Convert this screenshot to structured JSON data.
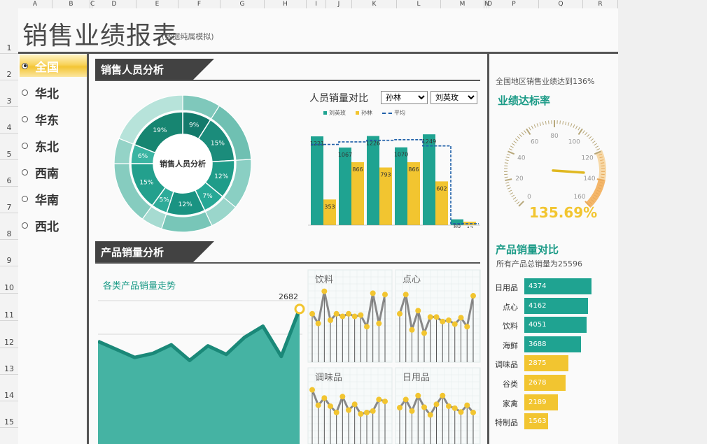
{
  "sheet": {
    "columns": [
      "A",
      "B",
      "C",
      "D",
      "E",
      "F",
      "G",
      "H",
      "I",
      "J",
      "K",
      "L",
      "M",
      "N",
      "O",
      "P",
      "Q",
      "R"
    ],
    "rows": [
      "1",
      "2",
      "3",
      "4",
      "5",
      "6",
      "7",
      "8",
      "9",
      "10",
      "11",
      "12",
      "13",
      "14",
      "15"
    ]
  },
  "header": {
    "title": "销售业绩报表",
    "subtitle": "(数据纯属模拟)"
  },
  "regions": {
    "items": [
      {
        "label": "全国",
        "selected": true
      },
      {
        "label": "华北",
        "selected": false
      },
      {
        "label": "华东",
        "selected": false
      },
      {
        "label": "东北",
        "selected": false
      },
      {
        "label": "西南",
        "selected": false
      },
      {
        "label": "华南",
        "selected": false
      },
      {
        "label": "西北",
        "selected": false
      }
    ]
  },
  "sales_section": {
    "title": "销售人员分析",
    "donut_center": "销售人员分析",
    "compare_title": "人员销量对比",
    "dropdown_a": "孙林",
    "dropdown_b": "刘英玫",
    "legend": {
      "a": "刘英玫",
      "b": "孙林",
      "avg": "平均"
    }
  },
  "product_section": {
    "title": "产品销量分析",
    "trend_title": "各类产品销量走势",
    "trend_max_label": "2682",
    "small_titles": [
      "饮料",
      "点心",
      "调味品",
      "日用品"
    ]
  },
  "kpi": {
    "caption": "全国地区销售业绩达到136%",
    "title": "业绩达标率",
    "value": "135.69%",
    "gauge_ticks": [
      "0",
      "20",
      "40",
      "60",
      "80",
      "100",
      "120",
      "140",
      "160"
    ]
  },
  "product_compare": {
    "title": "产品销量对比",
    "caption": "所有产品总销量为25596"
  },
  "colors": {
    "teal": "#1fa391",
    "gold": "#f2c530",
    "dark": "#424242",
    "avg_line": "#1f5fa8"
  },
  "chart_data": [
    {
      "type": "pie",
      "title": "销售人员分析",
      "values": [
        9,
        15,
        12,
        7,
        12,
        5,
        15,
        6,
        19
      ],
      "labels": [
        "9%",
        "15%",
        "12%",
        "7%",
        "12%",
        "5%",
        "15%",
        "6%",
        "19%"
      ]
    },
    {
      "type": "bar",
      "title": "人员销量对比",
      "series": [
        {
          "name": "刘英玫",
          "values": [
            1221,
            1067,
            1226,
            1070,
            1249,
            80
          ]
        },
        {
          "name": "孙林",
          "values": [
            353,
            866,
            793,
            866,
            602,
            47
          ]
        },
        {
          "name": "平均",
          "values": [
            1110,
            1145,
            1166,
            1175,
            1090,
            20
          ]
        }
      ],
      "ylim": [
        0,
        1400
      ]
    },
    {
      "type": "area",
      "title": "各类产品销量走势",
      "values": [
        2040,
        1880,
        1720,
        1800,
        1970,
        1660,
        1950,
        1780,
        2120,
        2340,
        1740,
        2682
      ],
      "ylim": [
        0,
        3000
      ]
    },
    {
      "type": "line",
      "title": "饮料",
      "values": [
        60,
        45,
        95,
        50,
        60,
        56,
        60,
        56,
        58,
        40,
        92,
        45,
        90
      ],
      "ylim": [
        0,
        100
      ]
    },
    {
      "type": "line",
      "title": "点心",
      "values": [
        60,
        90,
        35,
        65,
        30,
        55,
        55,
        48,
        50,
        44,
        54,
        40,
        88
      ],
      "ylim": [
        0,
        100
      ]
    },
    {
      "type": "line",
      "title": "调味品",
      "values": [
        92,
        60,
        75,
        58,
        45,
        78,
        50,
        62,
        42,
        45,
        48,
        72,
        68
      ],
      "ylim": [
        0,
        100
      ]
    },
    {
      "type": "line",
      "title": "日用品",
      "values": [
        55,
        72,
        48,
        80,
        56,
        40,
        62,
        80,
        58,
        54,
        46,
        60,
        45
      ],
      "ylim": [
        0,
        100
      ]
    },
    {
      "type": "bar",
      "title": "产品销量对比",
      "categories": [
        "日用品",
        "点心",
        "饮料",
        "海鲜",
        "调味品",
        "谷类",
        "家禽",
        "特制品"
      ],
      "values": [
        4374,
        4162,
        4051,
        3688,
        2875,
        2678,
        2189,
        1563
      ]
    }
  ]
}
